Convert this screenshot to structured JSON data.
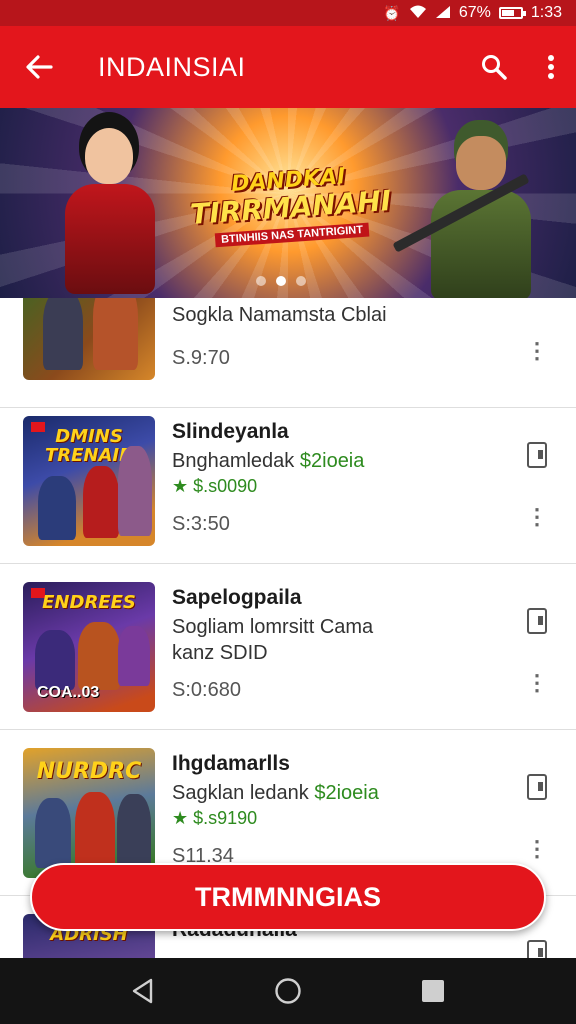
{
  "status_bar": {
    "battery": "67%",
    "time": "1:33",
    "battery_level": 0.67
  },
  "app_bar": {
    "title": "INDAINSIAI"
  },
  "banner": {
    "title_line1": "DANDKAI",
    "title_line2": "TIRRMANAHI",
    "subtitle": "BTINHIIS NAS TANTRIGINT",
    "slide_count": 3,
    "active_slide": 2
  },
  "list": {
    "items": [
      {
        "title": "",
        "line1": "Sogkla Namamsta Cblai",
        "line1_green": "",
        "rating": "",
        "price": "S.9:70",
        "thumb_text": "",
        "thumb_bottom": ""
      },
      {
        "title": "Slindeyanla",
        "line1": "Bnghamledak ",
        "line1_green": "$2ioeia",
        "rating": "★ $.s0090",
        "price": "S:3:50",
        "thumb_text": "DMINS TRENAIR",
        "thumb_bottom": ""
      },
      {
        "title": "Sapelogpaila",
        "line1": "Sogliam lomrsitt Cama",
        "line1_green": "",
        "line2": "kanz SDID",
        "rating": "",
        "price": "S:0:680",
        "thumb_text": "ENDREES",
        "thumb_bottom": "COA..03"
      },
      {
        "title": "Ihgdamarlls",
        "line1": "Sagklan ledank ",
        "line1_green": "$2ioeia",
        "rating": "★ $.s9190",
        "price": "S11.34",
        "thumb_text": "NURDRC",
        "thumb_bottom": ""
      },
      {
        "title": "Radadunalla",
        "line1": "",
        "line1_green": "",
        "rating": "",
        "price": "",
        "thumb_text": "ADRISH",
        "thumb_bottom": ""
      }
    ]
  },
  "fab": {
    "label": "TRMMNNGIAS"
  },
  "colors": {
    "primary": "#e3161c",
    "status": "#b7151b",
    "price_green": "#2e8b1f",
    "nav": "#141414"
  },
  "icons": [
    "back-arrow-icon",
    "search-icon",
    "more-vert-icon",
    "device-icon",
    "kebab-icon",
    "nav-back-icon",
    "nav-home-icon",
    "nav-recents-icon",
    "wifi-icon",
    "signal-icon",
    "battery-icon",
    "alarm-icon"
  ]
}
